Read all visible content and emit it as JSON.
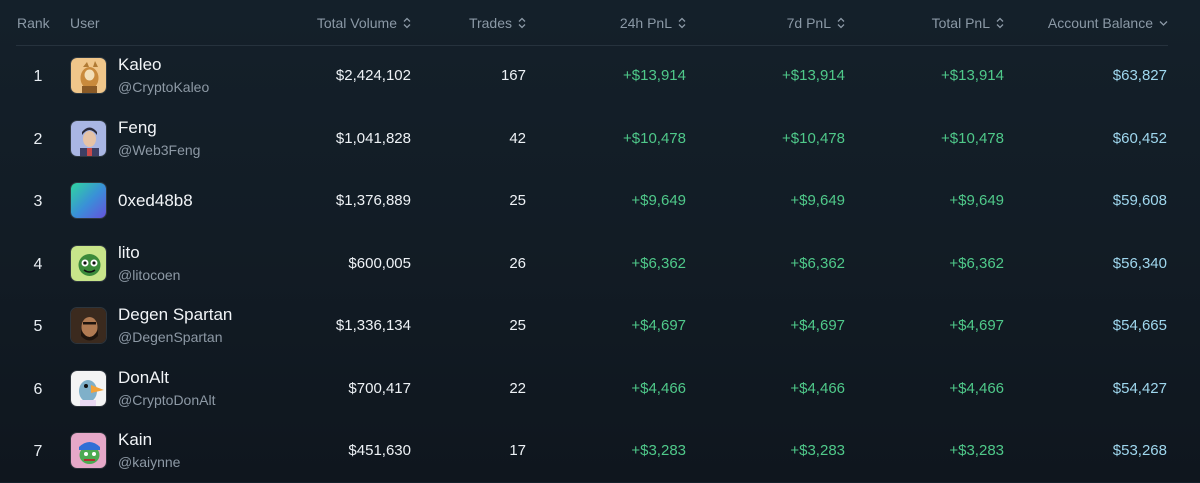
{
  "header": {
    "rank": "Rank",
    "user": "User",
    "total_volume": "Total Volume",
    "trades": "Trades",
    "pnl_24h": "24h PnL",
    "pnl_7d": "7d PnL",
    "pnl_total": "Total PnL",
    "account_balance": "Account Balance"
  },
  "rows": [
    {
      "rank": "1",
      "name": "Kaleo",
      "handle": "@CryptoKaleo",
      "total_volume": "$2,424,102",
      "trades": "167",
      "pnl_24h": "+$13,914",
      "pnl_7d": "+$13,914",
      "pnl_total": "+$13,914",
      "balance": "$63,827"
    },
    {
      "rank": "2",
      "name": "Feng",
      "handle": "@Web3Feng",
      "total_volume": "$1,041,828",
      "trades": "42",
      "pnl_24h": "+$10,478",
      "pnl_7d": "+$10,478",
      "pnl_total": "+$10,478",
      "balance": "$60,452"
    },
    {
      "rank": "3",
      "name": "0xed48b8",
      "handle": "",
      "total_volume": "$1,376,889",
      "trades": "25",
      "pnl_24h": "+$9,649",
      "pnl_7d": "+$9,649",
      "pnl_total": "+$9,649",
      "balance": "$59,608"
    },
    {
      "rank": "4",
      "name": "lito",
      "handle": "@litocoen",
      "total_volume": "$600,005",
      "trades": "26",
      "pnl_24h": "+$6,362",
      "pnl_7d": "+$6,362",
      "pnl_total": "+$6,362",
      "balance": "$56,340"
    },
    {
      "rank": "5",
      "name": "Degen Spartan",
      "handle": "@DegenSpartan",
      "total_volume": "$1,336,134",
      "trades": "25",
      "pnl_24h": "+$4,697",
      "pnl_7d": "+$4,697",
      "pnl_total": "+$4,697",
      "balance": "$54,665"
    },
    {
      "rank": "6",
      "name": "DonAlt",
      "handle": "@CryptoDonAlt",
      "total_volume": "$700,417",
      "trades": "22",
      "pnl_24h": "+$4,466",
      "pnl_7d": "+$4,466",
      "pnl_total": "+$4,466",
      "balance": "$54,427"
    },
    {
      "rank": "7",
      "name": "Kain",
      "handle": "@kaiynne",
      "total_volume": "$451,630",
      "trades": "17",
      "pnl_24h": "+$3,283",
      "pnl_7d": "+$3,283",
      "pnl_total": "+$3,283",
      "balance": "$53,268"
    }
  ],
  "icons": {
    "sort": "sort-updown-icon",
    "sort_active": "chevron-down-icon"
  },
  "colors": {
    "background": "#121c25",
    "positive": "#4fc98a",
    "balance": "#9fd7ee",
    "muted": "#8b99a6"
  }
}
